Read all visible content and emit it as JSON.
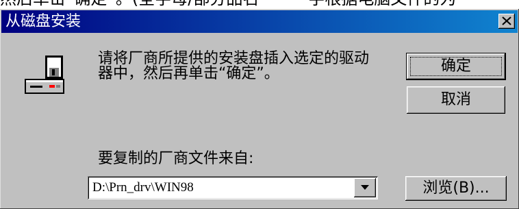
{
  "background_text": "然后单击“确定”。(全字母/部分品名———字根据电脑文件的为",
  "dialog": {
    "title": "从磁盘安装",
    "message_line1": "请将厂商所提供的安装盘插入选定的驱动",
    "message_line2": "器中，然后再单击“确定”。",
    "ok_label": "确定",
    "cancel_label": "取消",
    "copy_from_label": "要复制的厂商文件来自:",
    "path_value": "D:\\Prn_drv\\WIN98",
    "browse_label": "浏览(B)..."
  },
  "icons": {
    "close": "close-icon",
    "install": "floppy-drive-install-icon",
    "dropdown": "dropdown-arrow-icon"
  },
  "colors": {
    "titlebar_start": "#000080",
    "titlebar_end": "#1084d0",
    "face": "#c0c0c0"
  }
}
